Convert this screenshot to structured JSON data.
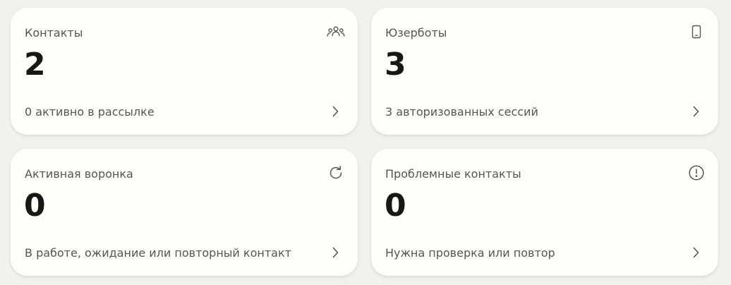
{
  "cards": [
    {
      "title": "Контакты",
      "value": "2",
      "subtitle": "0 активно в рассылке",
      "icon": "users-icon"
    },
    {
      "title": "Юзерботы",
      "value": "3",
      "subtitle": "3 авторизованных сессий",
      "icon": "phone-icon"
    },
    {
      "title": "Активная воронка",
      "value": "0",
      "subtitle": "В работе, ожидание или повторный контакт",
      "icon": "refresh-icon"
    },
    {
      "title": "Проблемные контакты",
      "value": "0",
      "subtitle": "Нужна проверка или повтор",
      "icon": "alert-circle-icon"
    }
  ],
  "colors": {
    "background": "#f1f1ee",
    "card": "#fdfdfb",
    "text_primary": "#171816",
    "text_secondary": "#55574f",
    "icon": "#55574f"
  }
}
